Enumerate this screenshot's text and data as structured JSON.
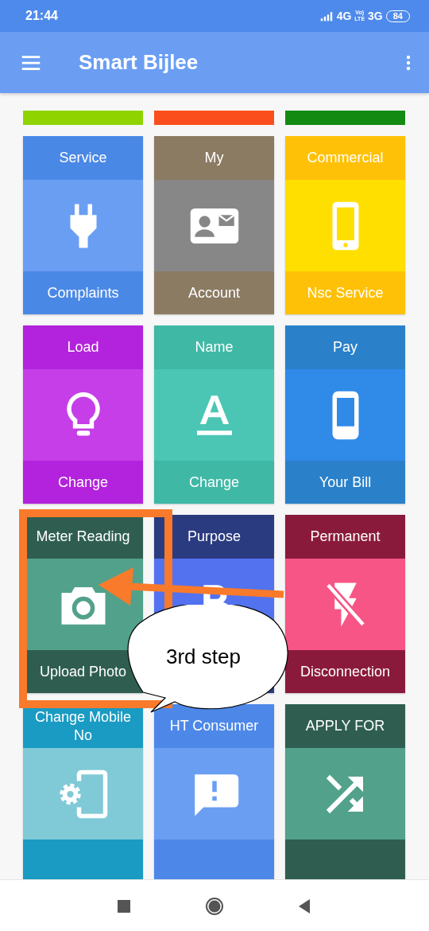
{
  "status_bar": {
    "time": "21:44",
    "network_1": "4G",
    "volte_top": "Vo)",
    "volte_bottom": "LTE",
    "network_2": "3G",
    "battery": "84"
  },
  "app_bar": {
    "title": "Smart Bijlee"
  },
  "partial_tiles": [
    {
      "color": "#8fd400"
    },
    {
      "color": "#fa4f1c"
    },
    {
      "color": "#138a12"
    }
  ],
  "tiles": [
    {
      "title": "Service",
      "caption": "Complaints",
      "color": "#4a88e6"
    },
    {
      "title": "My",
      "caption": "Account",
      "color": "#8b7b63"
    },
    {
      "title": "Commercial",
      "caption": "Nsc Service",
      "color": "#ffc107"
    },
    {
      "title": "Load",
      "caption": "Change",
      "color": "#b322dc"
    },
    {
      "title": "Name",
      "caption": "Change",
      "color": "#40b8a6"
    },
    {
      "title": "Pay",
      "caption": "Your Bill",
      "color": "#2a80c9"
    },
    {
      "title": "Meter Reading",
      "caption": "Upload Photo",
      "color": "#2f5e50"
    },
    {
      "title": "Purpose",
      "color": "#2b3b80"
    },
    {
      "title": "Permanent",
      "caption": "Disconnection",
      "color": "#8a1a3b"
    },
    {
      "title": "Change Mobile No",
      "color": "#1a9bc3"
    },
    {
      "title": "HT Consumer",
      "color": "#4d88e8"
    },
    {
      "title": "APPLY FOR",
      "color": "#2f5e50"
    }
  ],
  "annotations": [
    {
      "kind": "box"
    },
    {
      "kind": "arrow"
    },
    {
      "kind": "callout",
      "text": "3rd step"
    }
  ]
}
